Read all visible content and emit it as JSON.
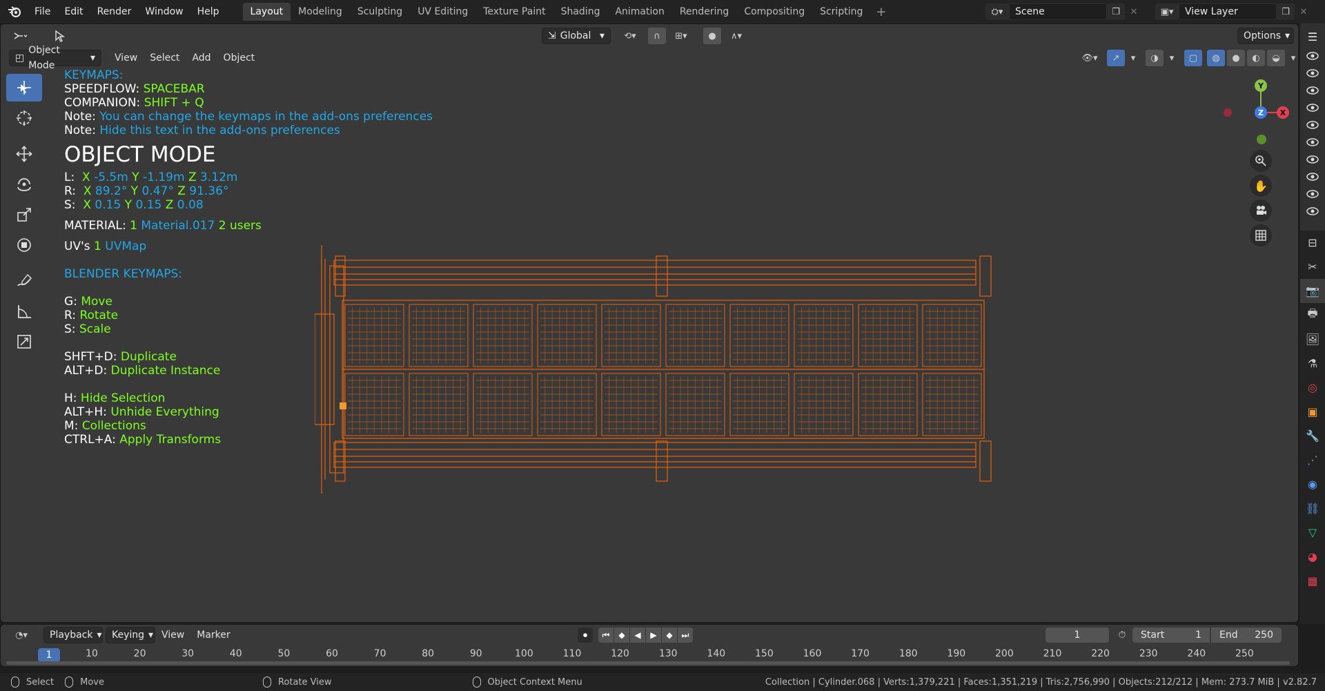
{
  "topbar": {
    "menus": [
      "File",
      "Edit",
      "Render",
      "Window",
      "Help"
    ],
    "workspaces": [
      "Layout",
      "Modeling",
      "Sculpting",
      "UV Editing",
      "Texture Paint",
      "Shading",
      "Animation",
      "Rendering",
      "Compositing",
      "Scripting"
    ],
    "active_workspace": "Layout",
    "scene": "Scene",
    "view_layer": "View Layer"
  },
  "viewport_header": {
    "transform_orientation": "Global",
    "options": "Options",
    "mode": "Object Mode",
    "menus": [
      "View",
      "Select",
      "Add",
      "Object"
    ]
  },
  "overlay": {
    "keymaps_title": "KEYMAPS:",
    "speedflow_label": "SPEEDFLOW:",
    "speedflow_key": "SPACEBAR",
    "companion_label": "COMPANION:",
    "companion_key": "SHIFT + Q",
    "note_label": "Note:",
    "note1": "You can change the keymaps in the add-ons preferences",
    "note2": "Hide this text in the add-ons preferences",
    "mode_title": "OBJECT MODE",
    "loc_label": "L:",
    "loc": {
      "x": "-5.5m",
      "y": "-1.19m",
      "z": "3.12m"
    },
    "rot_label": "R:",
    "rot": {
      "x": "89.2°",
      "y": "0.47°",
      "z": "91.36°"
    },
    "scale_label": "S:",
    "scale": {
      "x": "0.15",
      "y": "0.15",
      "z": "0.08"
    },
    "material_label": "MATERIAL:",
    "material_count": "1",
    "material_name": "Material.017",
    "material_users": "2 users",
    "uv_label": "UV's",
    "uv_count": "1",
    "uv_name": "UVMap",
    "blender_keymaps": "BLENDER KEYMAPS:",
    "keys": [
      {
        "k": "G:",
        "v": "Move"
      },
      {
        "k": "R:",
        "v": "Rotate"
      },
      {
        "k": "S:",
        "v": "Scale"
      },
      {
        "k": "SHFT+D:",
        "v": "Duplicate"
      },
      {
        "k": "ALT+D:",
        "v": "Duplicate Instance"
      },
      {
        "k": "H:",
        "v": "Hide Selection"
      },
      {
        "k": "ALT+H:",
        "v": "Unhide Everything"
      },
      {
        "k": "M:",
        "v": "Collections"
      },
      {
        "k": "CTRL+A:",
        "v": "Apply Transforms"
      }
    ],
    "axis_x": "X",
    "axis_y": "Y",
    "axis_z": "Z"
  },
  "gizmo": {
    "x": "X",
    "y": "Y",
    "z": "Z"
  },
  "timeline": {
    "menus": [
      "Playback",
      "Keying",
      "View",
      "Marker"
    ],
    "current_frame": "1",
    "start_label": "Start",
    "start": "1",
    "end_label": "End",
    "end": "250",
    "ticks": [
      "10",
      "20",
      "30",
      "40",
      "50",
      "60",
      "70",
      "80",
      "90",
      "100",
      "110",
      "120",
      "130",
      "140",
      "150",
      "160",
      "170",
      "180",
      "190",
      "200",
      "210",
      "220",
      "230",
      "240",
      "250"
    ],
    "cursor": "1"
  },
  "statusbar": {
    "select": "Select",
    "move": "Move",
    "rotate_view": "Rotate View",
    "context_menu": "Object Context Menu",
    "stats": "Collection | Cylinder.068 | Verts:1,379,221 | Faces:1,351,219 | Tris:2,756,990 | Objects:212/212 | Mem: 273.7 MiB | v2.82.7"
  },
  "colors": {
    "accent": "#4772b3",
    "wire": "#e8600a",
    "overlay_blue": "#22a7e6",
    "overlay_green": "#7dff1f"
  }
}
